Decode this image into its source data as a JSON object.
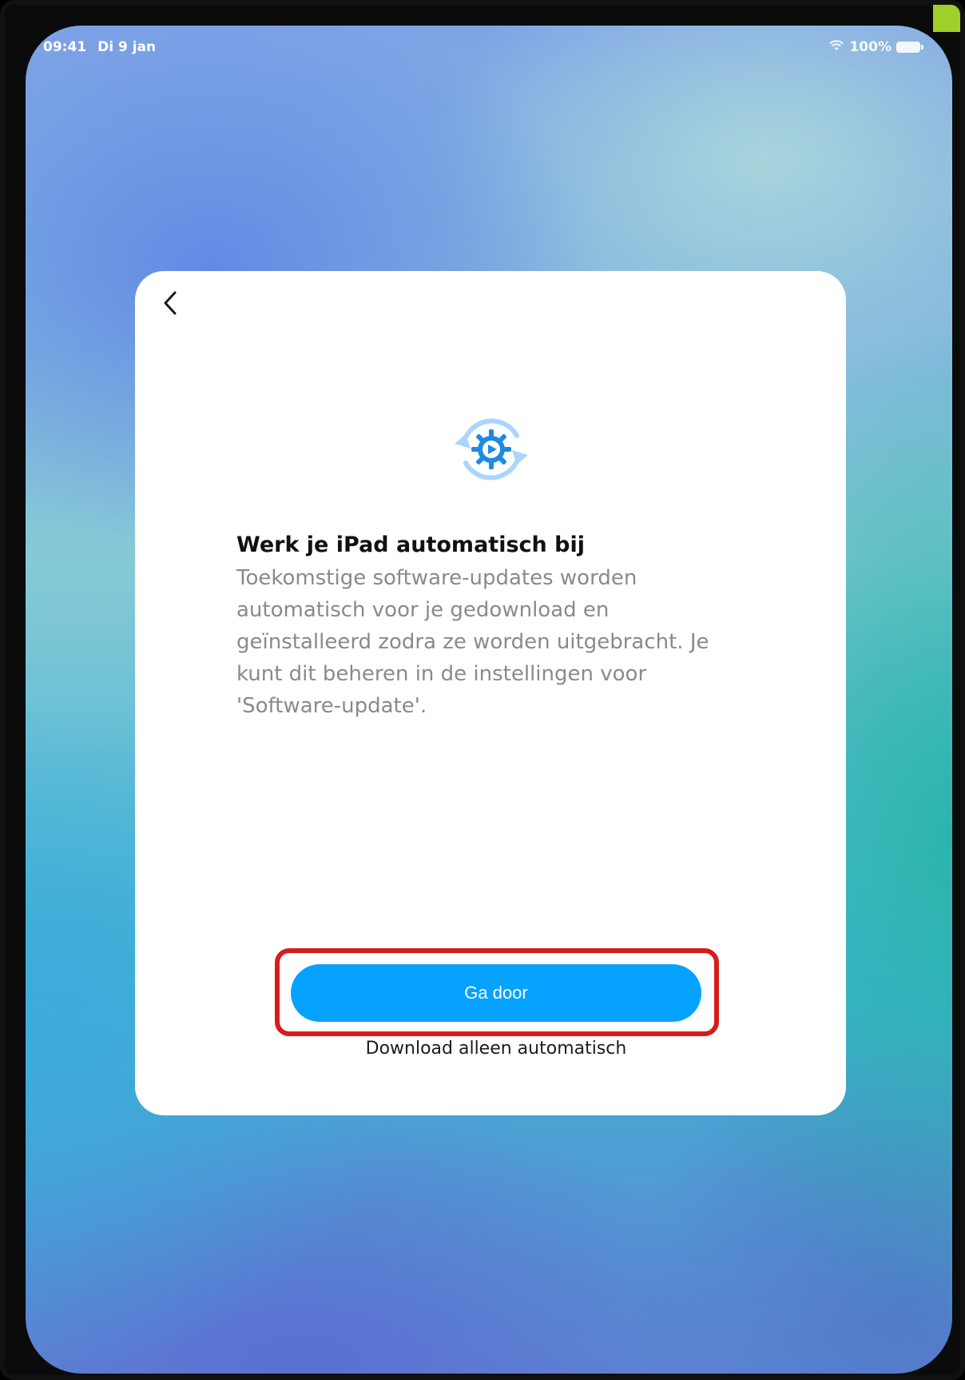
{
  "status_bar": {
    "time": "09:41",
    "date": "Di 9 jan",
    "battery": "100%"
  },
  "card": {
    "back_icon": "chevron-left-icon",
    "title": "Werk je iPad automatisch bij",
    "description": "Toekomstige software-updates worden automatisch voor je gedownload en geïnstalleerd zodra ze worden uitgebracht. Je kunt dit beheren in de instellingen voor 'Software-update'.",
    "primary_button": "Ga door",
    "secondary_link": "Download alleen automatisch"
  },
  "colors": {
    "accent": "#05A2FF",
    "highlight": "#D61C1C",
    "icon": "#1E8BE0"
  }
}
